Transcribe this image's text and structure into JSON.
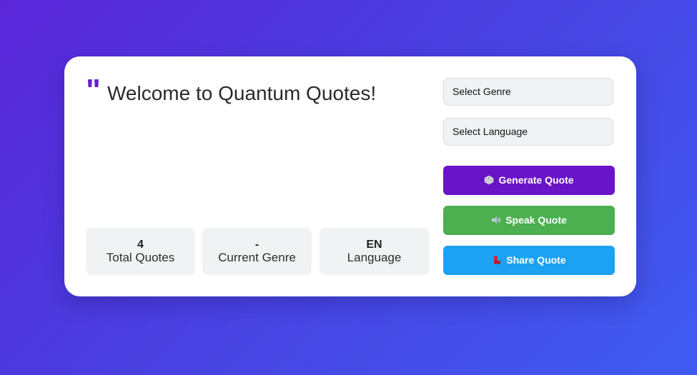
{
  "quote": {
    "mark": "\"",
    "text": "Welcome to Quantum Quotes!"
  },
  "stats": [
    {
      "value": "4",
      "label": "Total Quotes"
    },
    {
      "value": "-",
      "label": "Current Genre"
    },
    {
      "value": "EN",
      "label": "Language"
    }
  ],
  "selects": {
    "genre": "Select Genre",
    "language": "Select Language"
  },
  "buttons": {
    "generate": {
      "icon": "dice-icon",
      "label": "Generate Quote"
    },
    "speak": {
      "icon": "speaker-icon",
      "label": "Speak Quote"
    },
    "share": {
      "icon": "share-icon",
      "label": "Share Quote"
    }
  },
  "colors": {
    "accent_purple": "#6a14c8",
    "speak_green": "#4caf50",
    "share_blue": "#1da1f2"
  }
}
